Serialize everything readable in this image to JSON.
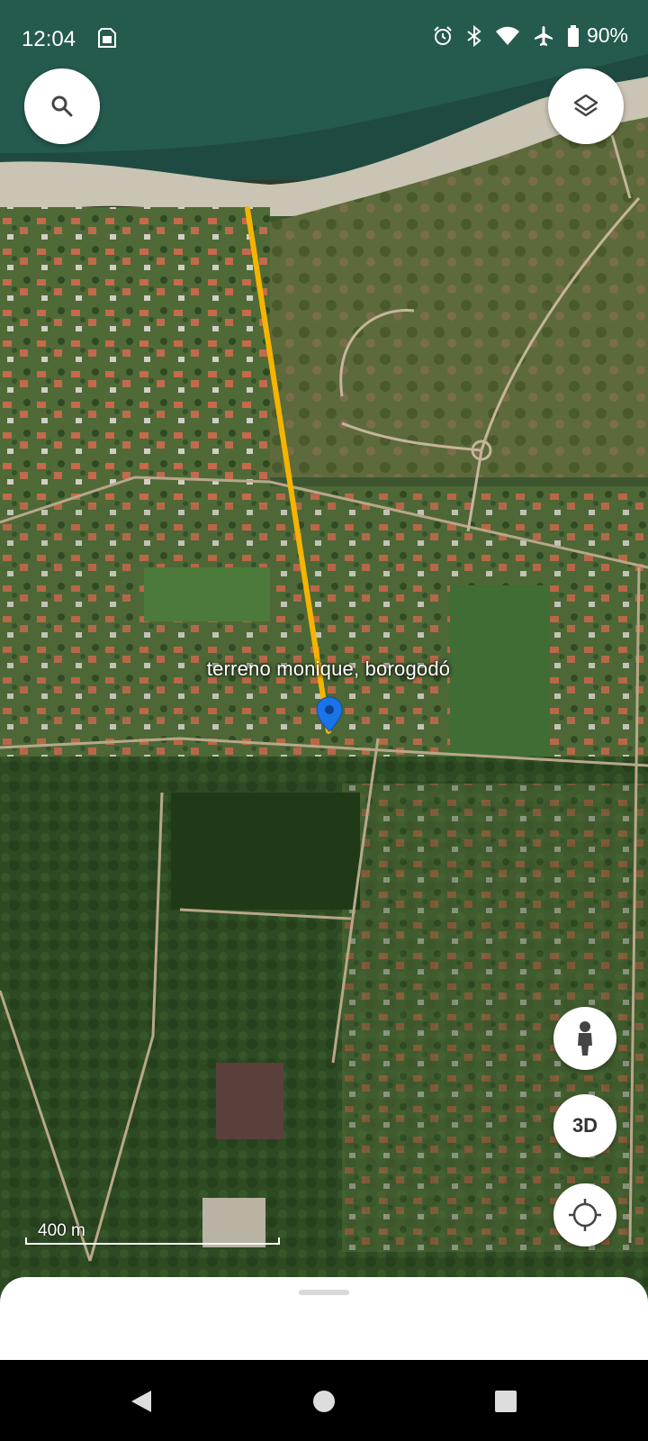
{
  "status_bar": {
    "time": "12:04",
    "battery": "90%",
    "icons": [
      "sim-card-icon",
      "alarm-icon",
      "bluetooth-icon",
      "wifi-icon",
      "airplane-mode-icon",
      "battery-icon"
    ]
  },
  "map": {
    "type": "satellite",
    "place_label": "terreno monique, borogodó",
    "measure_line_color": "#f5b400",
    "pin_color": "#1a73e8",
    "scale_label": "400 m"
  },
  "controls": {
    "search_icon": "search-icon",
    "layers_icon": "layers-icon",
    "street_view_icon": "pegman-icon",
    "view_3d_label": "3D",
    "my_location_icon": "my-location-icon"
  },
  "navigation": [
    "back-icon",
    "home-icon",
    "recents-icon"
  ]
}
